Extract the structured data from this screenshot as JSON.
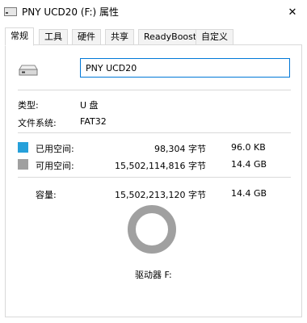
{
  "window": {
    "title": "PNY UCD20 (F:) 属性",
    "close_glyph": "✕"
  },
  "tabs": [
    "常规",
    "工具",
    "硬件",
    "共享",
    "ReadyBoost",
    "自定义"
  ],
  "general": {
    "drive_name_value": "PNY UCD20",
    "type_label": "类型:",
    "type_value": "U 盘",
    "fs_label": "文件系统:",
    "fs_value": "FAT32",
    "used": {
      "label": "已用空间:",
      "bytes": "98,304 字节",
      "size": "96.0 KB",
      "color": "#26a0da"
    },
    "free": {
      "label": "可用空间:",
      "bytes": "15,502,114,816 字节",
      "size": "14.4 GB",
      "color": "#a0a0a0"
    },
    "capacity": {
      "label": "容量:",
      "bytes": "15,502,213,120 字节",
      "size": "14.4 GB"
    },
    "used_fraction": 6.3e-06,
    "drive_label": "驱动器 F:"
  }
}
